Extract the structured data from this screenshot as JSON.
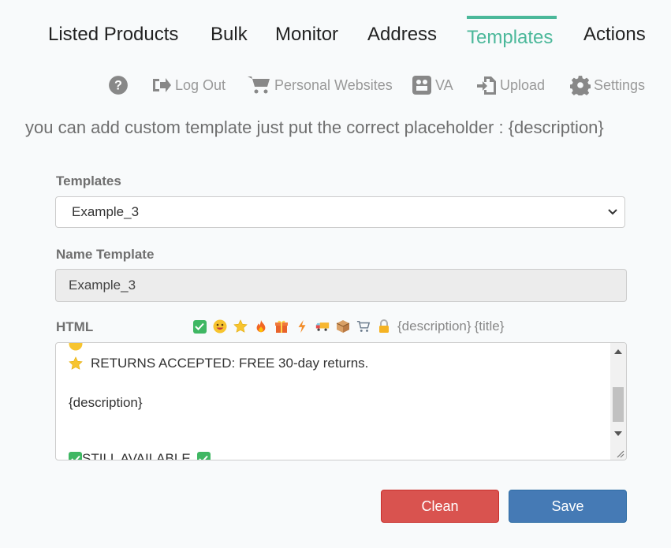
{
  "nav": {
    "tabs": [
      "Listed Products",
      "Bulk",
      "Monitor",
      "Address",
      "Templates",
      "Actions"
    ],
    "active": "Templates"
  },
  "subnav": {
    "help_icon": "question-circle-icon",
    "logout": "Log Out",
    "websites": "Personal Websites",
    "va": "VA",
    "upload": "Upload",
    "settings": "Settings"
  },
  "hint": "you can add custom template just put the correct placeholder : {description}",
  "form": {
    "templates_label": "Templates",
    "templates_selected": "Example_3",
    "name_label": "Name Template",
    "name_value": "Example_3",
    "html_label": "HTML",
    "emojis": [
      "check-mark-icon",
      "grinning-face-icon",
      "star-icon",
      "fire-icon",
      "gift-icon",
      "lightning-icon",
      "truck-icon",
      "package-icon",
      "cart-icon",
      "lock-icon"
    ],
    "placeholder_description": "{description}",
    "placeholder_title": "{title}",
    "html_lines": [
      "RETURNS ACCEPTED: FREE 30-day returns.",
      "",
      "{description}",
      "",
      "",
      "STILL AVAILABLE"
    ]
  },
  "buttons": {
    "clean": "Clean",
    "save": "Save"
  },
  "colors": {
    "accent": "#4bb89a",
    "clean": "#d9534f",
    "save": "#457ab5"
  }
}
